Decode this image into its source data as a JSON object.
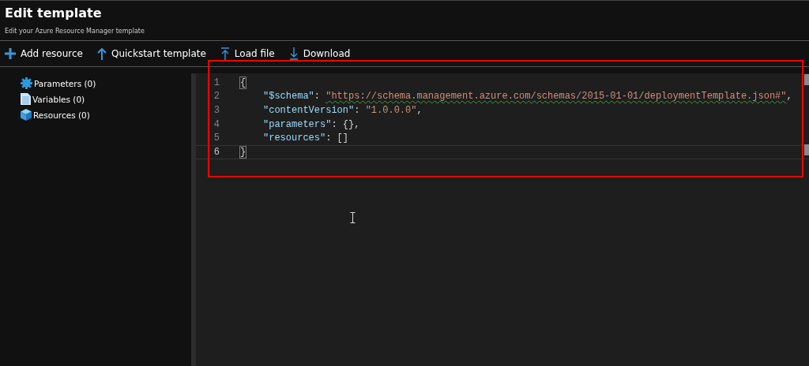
{
  "header": {
    "title": "Edit template",
    "subtitle": "Edit your Azure Resource Manager template"
  },
  "toolbar": [
    {
      "kind": "add",
      "label": "Add resource"
    },
    {
      "kind": "up",
      "label": "Quickstart template"
    },
    {
      "kind": "load",
      "label": "Load file"
    },
    {
      "kind": "download",
      "label": "Download"
    }
  ],
  "sidebar": {
    "items": [
      {
        "kind": "gear",
        "label": "Parameters (0)"
      },
      {
        "kind": "document",
        "label": "Variables (0)"
      },
      {
        "kind": "cube",
        "label": "Resources (0)"
      }
    ]
  },
  "editor": {
    "lines": [
      {
        "number": "1",
        "current": false,
        "tokens": [
          {
            "kind": "punct",
            "text": "{",
            "matched": true
          }
        ],
        "children": [
          {
            "number": "2",
            "current": false,
            "tokens": [
              {
                "kind": "key",
                "text": "\"$schema\""
              },
              {
                "kind": "punct",
                "text": ": "
              },
              {
                "kind": "string",
                "text": "\"https://schema.management.azure.com/schemas/2015-01-01/deploymentTemplate.json#\"",
                "warning": true
              },
              {
                "kind": "punct",
                "text": ","
              }
            ]
          },
          {
            "number": "3",
            "current": false,
            "tokens": [
              {
                "kind": "key",
                "text": "\"contentVersion\""
              },
              {
                "kind": "punct",
                "text": ": "
              },
              {
                "kind": "string",
                "text": "\"1.0.0.0\""
              },
              {
                "kind": "punct",
                "text": ","
              }
            ]
          },
          {
            "number": "4",
            "current": false,
            "tokens": [
              {
                "kind": "key",
                "text": "\"parameters\""
              },
              {
                "kind": "punct",
                "text": ": {},"
              }
            ]
          },
          {
            "number": "5",
            "current": false,
            "tokens": [
              {
                "kind": "key",
                "text": "\"resources\""
              },
              {
                "kind": "punct",
                "text": ": []"
              }
            ]
          }
        ]
      },
      {
        "number": "6",
        "current": true,
        "tokens": [
          {
            "kind": "punct",
            "text": "}",
            "matched": true
          }
        ]
      }
    ]
  }
}
